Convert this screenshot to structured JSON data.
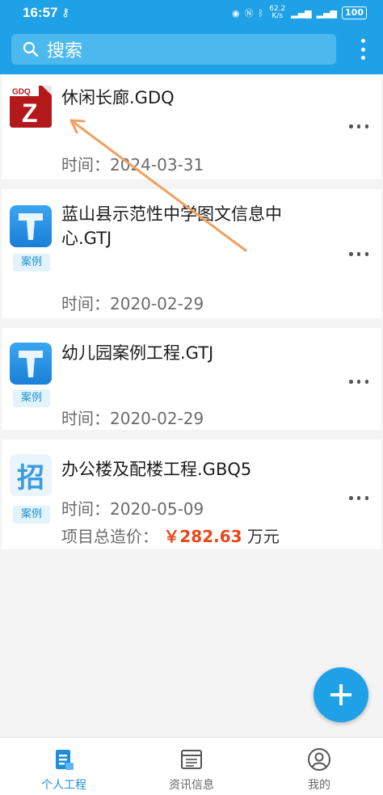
{
  "status": {
    "time": "16:57",
    "net_speed": "62.2\nK/s",
    "battery": "100"
  },
  "search": {
    "label": "搜索"
  },
  "cards": [
    {
      "title": "休闲长廊.GDQ",
      "icon_label": "GDQ",
      "date_label": "时间：2024-03-31"
    },
    {
      "title": "蓝山县示范性中学图文信息中心.GTJ",
      "tag": "案例",
      "date_label": "时间：2020-02-29"
    },
    {
      "title": "幼儿园案例工程.GTJ",
      "tag": "案例",
      "date_label": "时间：2020-02-29"
    },
    {
      "title": "办公楼及配楼工程.GBQ5",
      "tag": "案例",
      "icon_char": "招",
      "date_label": "时间：2020-05-09",
      "price_label": "项目总造价：",
      "price_value": "￥282.63",
      "price_unit": "万元"
    }
  ],
  "bottom_nav": [
    {
      "label": "个人工程",
      "active": true
    },
    {
      "label": "资讯信息",
      "active": false
    },
    {
      "label": "我的",
      "active": false
    }
  ],
  "colors": {
    "primary": "#1ea1e6",
    "price": "#e8471a",
    "annotation_arrow": "#f0a060"
  }
}
